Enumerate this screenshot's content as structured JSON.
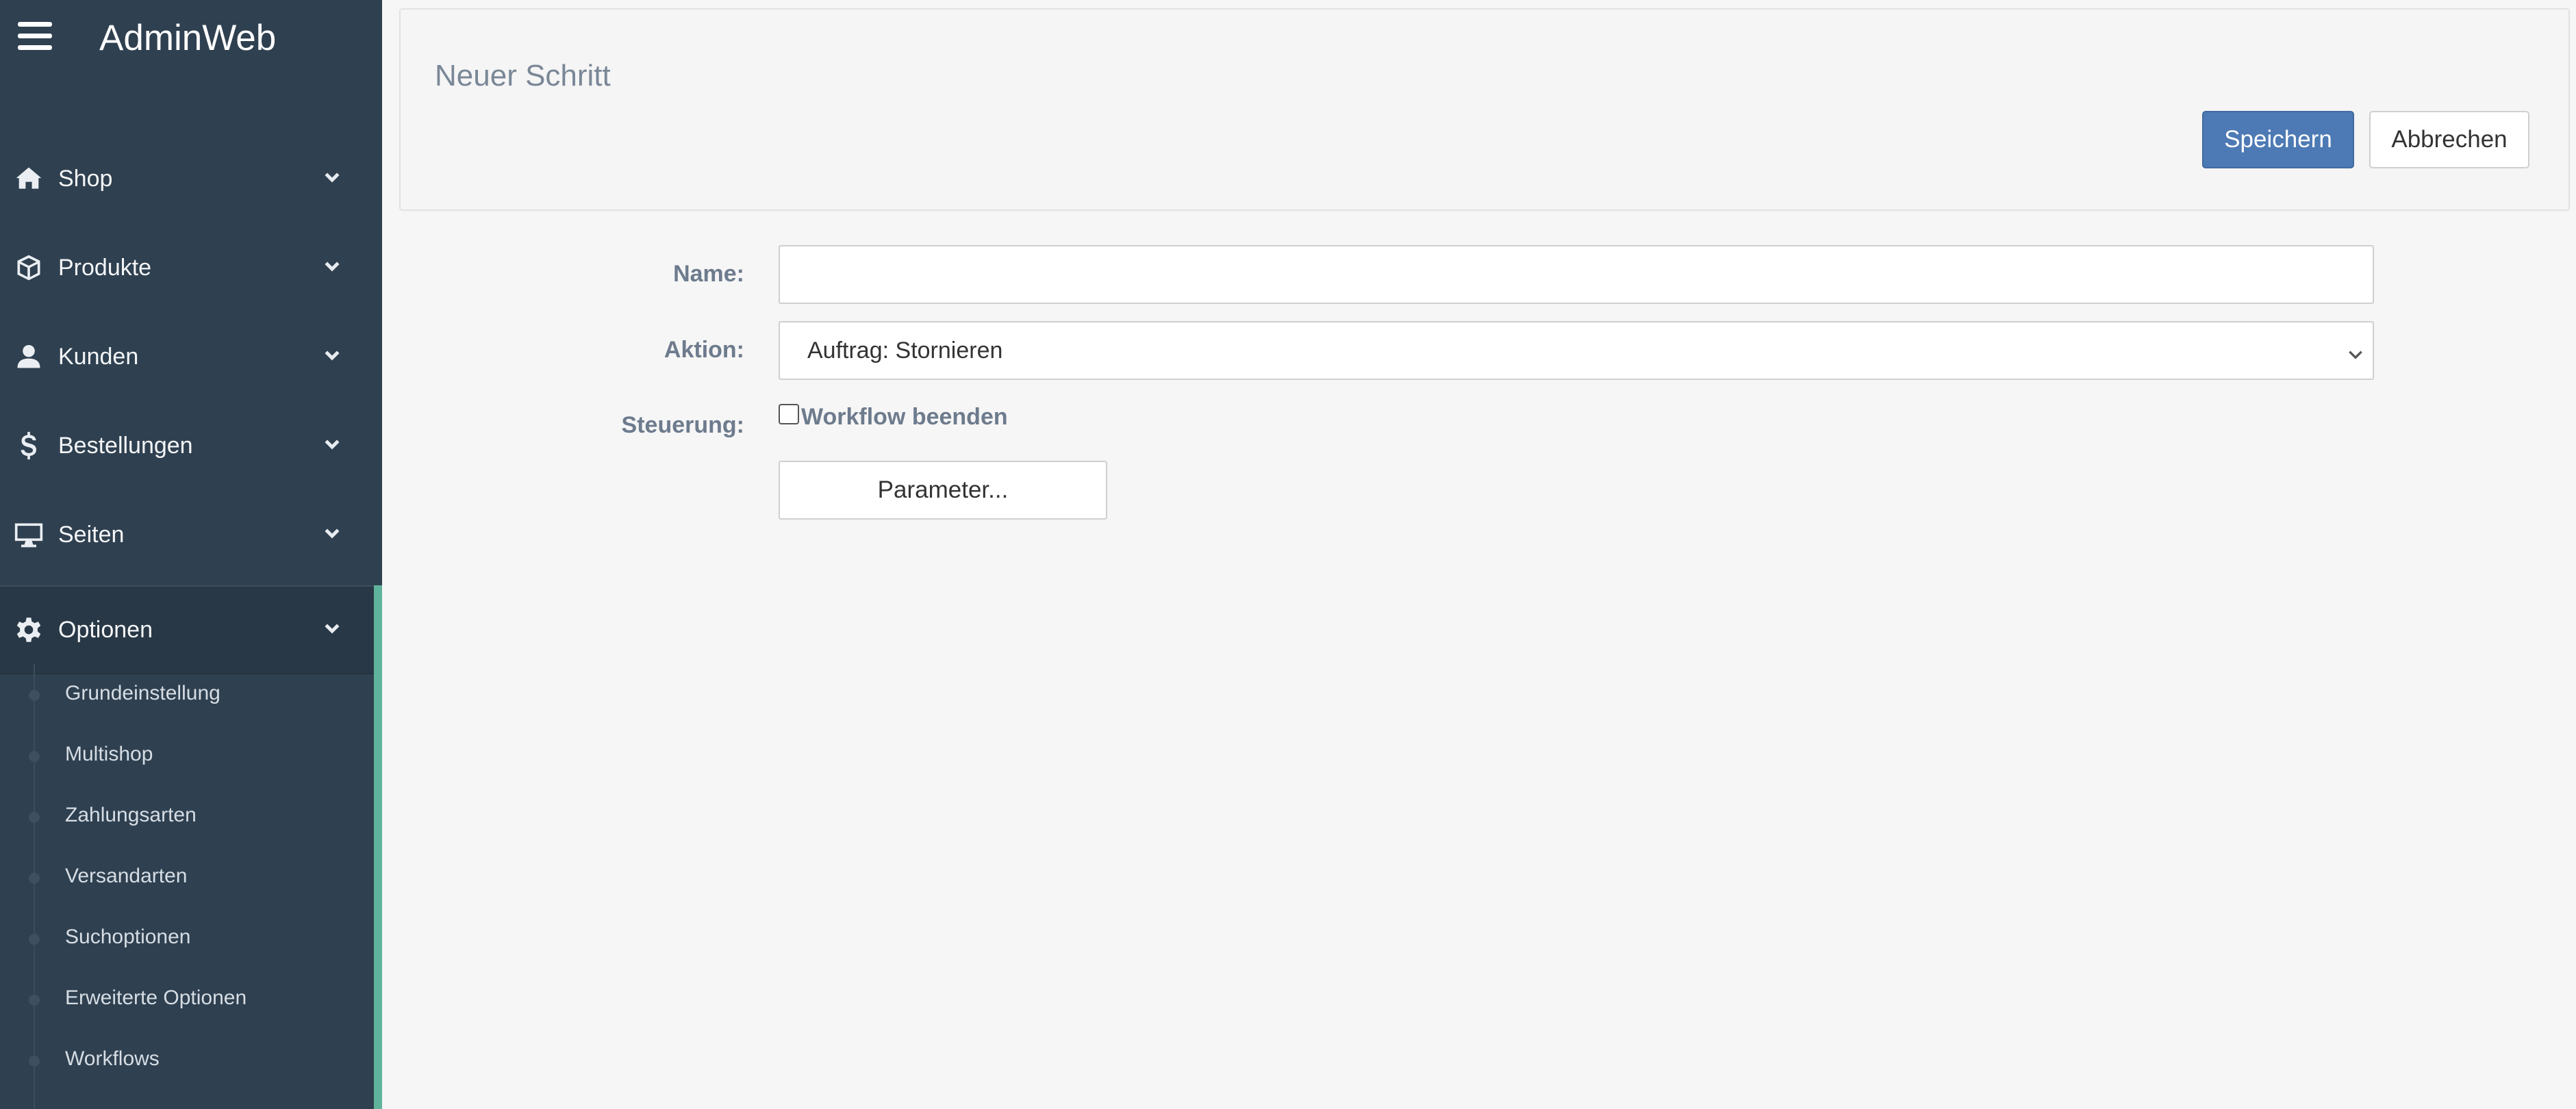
{
  "app": {
    "title": "AdminWeb"
  },
  "sidebar": {
    "items": [
      {
        "label": "Shop",
        "icon": "home-icon"
      },
      {
        "label": "Produkte",
        "icon": "box-icon"
      },
      {
        "label": "Kunden",
        "icon": "user-icon"
      },
      {
        "label": "Bestellungen",
        "icon": "dollar-icon"
      },
      {
        "label": "Seiten",
        "icon": "monitor-icon"
      },
      {
        "label": "Optionen",
        "icon": "gear-icon",
        "active": true
      }
    ],
    "subitems": [
      {
        "label": "Grundeinstellung"
      },
      {
        "label": "Multishop"
      },
      {
        "label": "Zahlungsarten"
      },
      {
        "label": "Versandarten"
      },
      {
        "label": "Suchoptionen"
      },
      {
        "label": "Erweiterte Optionen"
      },
      {
        "label": "Workflows"
      }
    ],
    "active_accent": "#5fb39a"
  },
  "header": {
    "title": "Neuer Schritt",
    "save_label": "Speichern",
    "cancel_label": "Abbrechen"
  },
  "form": {
    "name": {
      "label": "Name:",
      "value": "",
      "placeholder": ""
    },
    "action": {
      "label": "Aktion:",
      "value": "Auftrag: Stornieren"
    },
    "control": {
      "label": "Steuerung:",
      "checkbox_label": "Workflow beenden",
      "checked": false
    },
    "parameter_label": "Parameter..."
  },
  "colors": {
    "sidebar_bg": "#2f4050",
    "primary": "#4d7ab4",
    "page_bg": "#f6f6f6"
  }
}
